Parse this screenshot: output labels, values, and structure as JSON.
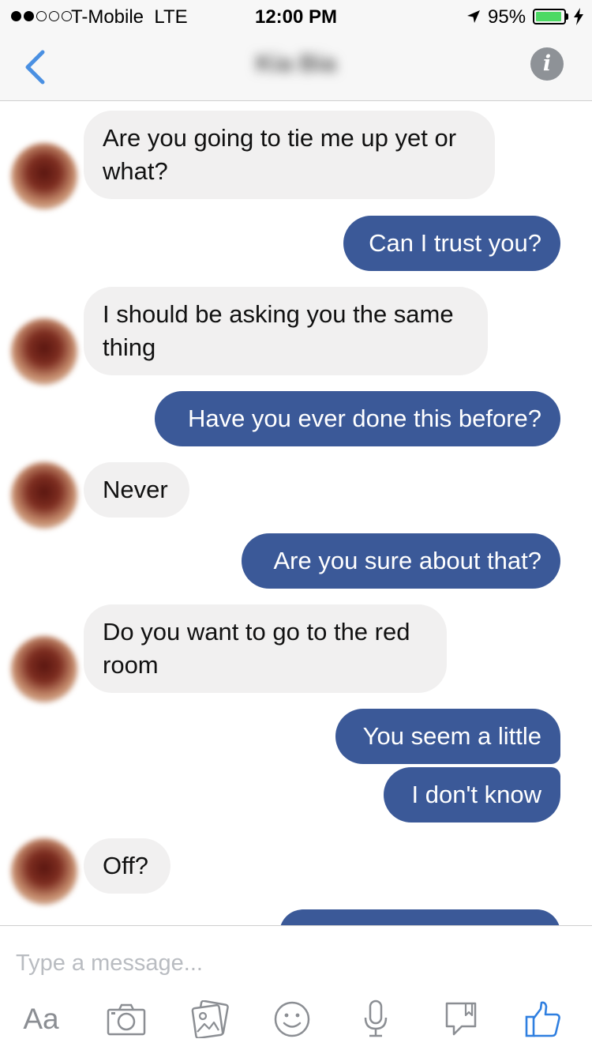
{
  "status_bar": {
    "carrier": "T-Mobile",
    "network": "LTE",
    "time": "12:00 PM",
    "battery": "95%",
    "battery_level": 0.95,
    "battery_color": "#4cd964"
  },
  "header": {
    "contact_name": "Kia Bia",
    "back_icon": "chevron-left-icon",
    "info_icon": "info-icon",
    "accent_color": "#4a90e2"
  },
  "messages": [
    {
      "direction": "in",
      "text": "Are you going to tie me up yet or what?"
    },
    {
      "direction": "out",
      "text": "Can I trust you?"
    },
    {
      "direction": "in",
      "text": "I should be asking you the same thing"
    },
    {
      "direction": "out",
      "text": "Have you ever done this before?"
    },
    {
      "direction": "in",
      "text": "Never"
    },
    {
      "direction": "out",
      "text": "Are you sure about that?"
    },
    {
      "direction": "in",
      "text": "Do you want to go to the red room"
    },
    {
      "direction": "out",
      "text": "You seem a little"
    },
    {
      "direction": "out",
      "text": "I don't know"
    },
    {
      "direction": "in",
      "text": "Off?"
    }
  ],
  "bubble_colors": {
    "incoming": "#f1f0f0",
    "outgoing": "#3b5998"
  },
  "composer": {
    "placeholder": "Type a message...",
    "text_format_label": "Aa",
    "icons": [
      "camera-icon",
      "photo-gallery-icon",
      "emoji-icon",
      "microphone-icon",
      "sticker-icon",
      "thumbs-up-icon"
    ],
    "like_color": "#2f7fe0"
  }
}
